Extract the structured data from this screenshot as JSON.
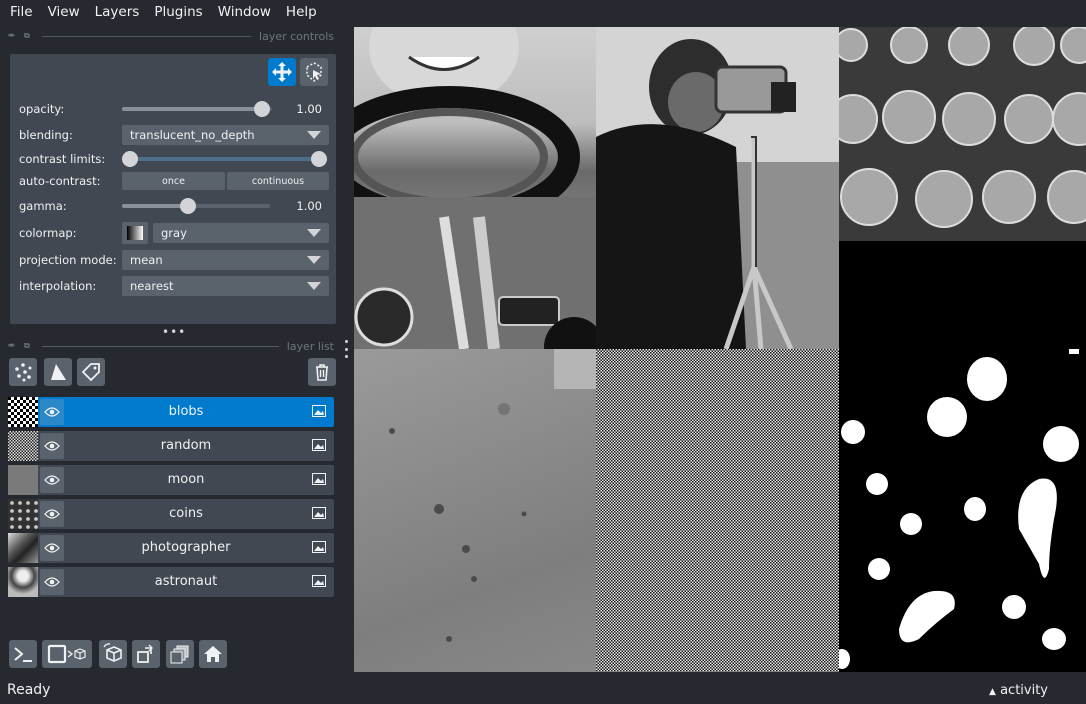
{
  "menu": [
    "File",
    "View",
    "Layers",
    "Plugins",
    "Window",
    "Help"
  ],
  "dock_titles": {
    "layer_controls": "layer controls",
    "layer_list": "layer list"
  },
  "controls": {
    "opacity": {
      "label": "opacity:",
      "value": "1.00",
      "fraction": 1.0
    },
    "blending": {
      "label": "blending:",
      "value": "translucent_no_depth"
    },
    "contrast_limits": {
      "label": "contrast limits:",
      "low": 0.0,
      "high": 1.0
    },
    "auto_contrast": {
      "label": "auto-contrast:",
      "once": "once",
      "continuous": "continuous"
    },
    "gamma": {
      "label": "gamma:",
      "value": "1.00",
      "fraction": 0.45
    },
    "colormap": {
      "label": "colormap:",
      "value": "gray"
    },
    "projection_mode": {
      "label": "projection mode:",
      "value": "mean"
    },
    "interpolation": {
      "label": "interpolation:",
      "value": "nearest"
    }
  },
  "layers": [
    {
      "name": "blobs",
      "selected": true
    },
    {
      "name": "random",
      "selected": false
    },
    {
      "name": "moon",
      "selected": false
    },
    {
      "name": "coins",
      "selected": false
    },
    {
      "name": "photographer",
      "selected": false
    },
    {
      "name": "astronaut",
      "selected": false
    }
  ],
  "icons": {
    "pan_zoom": "move-icon",
    "transform": "transform-icon",
    "points": "new-points-icon",
    "shapes": "new-shapes-icon",
    "labels": "new-labels-icon",
    "delete": "trash-icon",
    "visibility": "eye-icon",
    "image_layer": "image-icon",
    "console": "console-icon",
    "ndisplay": "ndisplay-icon",
    "roll": "roll-icon",
    "transpose": "transpose-icon",
    "grid": "grid-icon",
    "home": "home-icon"
  },
  "colors": {
    "accent": "#007acc",
    "panel": "#414851",
    "background": "#262930",
    "button": "#5a626c"
  },
  "status": {
    "left": "Ready",
    "activity": "activity"
  }
}
